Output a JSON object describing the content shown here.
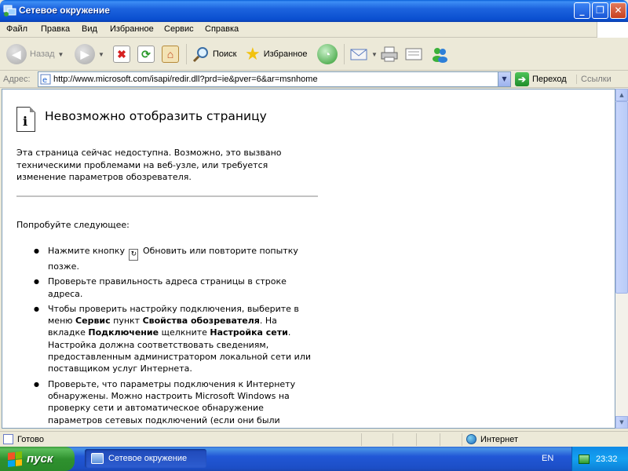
{
  "window": {
    "title": "Сетевое окружение",
    "minimize": "_",
    "maximize": "❐",
    "close": "✕"
  },
  "menu": [
    "Файл",
    "Правка",
    "Вид",
    "Избранное",
    "Сервис",
    "Справка"
  ],
  "toolbar": {
    "back_label": "Назад",
    "search_label": "Поиск",
    "favorites_label": "Избранное"
  },
  "address": {
    "label": "Адрес:",
    "url": "http://www.microsoft.com/isapi/redir.dll?prd=ie&pver=6&ar=msnhome",
    "go_label": "Переход",
    "links_label": "Ссылки"
  },
  "page": {
    "heading": "Невозможно отобразить страницу",
    "intro": "Эта страница сейчас недоступна. Возможно, это вызвано техническими проблемами на веб-узле, или требуется изменение параметров обозревателя.",
    "try_label": "Попробуйте следующее:",
    "b1_before": "Нажмите кнопку",
    "b1_after": "Обновить или повторите попытку позже.",
    "b2": "Проверьте правильность адреса страницы в строке адреса.",
    "b3_p1": "Чтобы проверить настройку подключения, выберите в меню",
    "b3_bold1": "Сервис",
    "b3_p2": "пункт",
    "b3_bold2": "Свойства обозревателя",
    "b3_p3": ". На вкладке",
    "b3_bold3": "Подключение",
    "b3_p4": "щелкните",
    "b3_bold4": "Настройка сети",
    "b3_p5": ". Настройка должна соответствовать сведениям, предоставленным администратором локальной сети или поставщиком услуг Интернета.",
    "b4": "Проверьте, что параметры подключения к Интернету обнаружены. Можно настроить Microsoft Windows на проверку сети и автоматическое обнаружение параметров сетевых подключений (если они были включены сетевым администратором)."
  },
  "status": {
    "left": "Готово",
    "zone": "Интернет"
  },
  "taskbar": {
    "start_label": "пуск",
    "task_label": "Сетевое окружение",
    "lang": "EN",
    "clock": "23:32"
  }
}
